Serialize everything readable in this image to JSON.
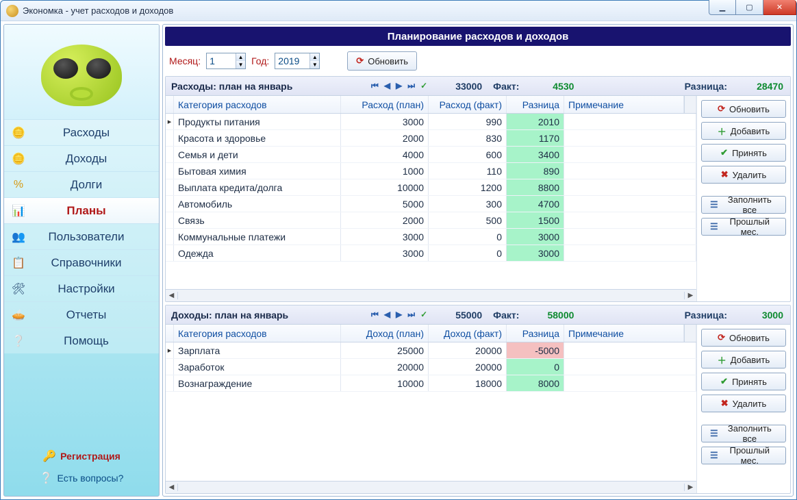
{
  "window": {
    "title": "Экономка - учет расходов и доходов"
  },
  "sidebar": {
    "items": [
      {
        "id": "expenses",
        "label": "Расходы"
      },
      {
        "id": "incomes",
        "label": "Доходы"
      },
      {
        "id": "debts",
        "label": "Долги"
      },
      {
        "id": "plans",
        "label": "Планы"
      },
      {
        "id": "users",
        "label": "Пользователи"
      },
      {
        "id": "refs",
        "label": "Справочники"
      },
      {
        "id": "settings",
        "label": "Настройки"
      },
      {
        "id": "reports",
        "label": "Отчеты"
      },
      {
        "id": "help",
        "label": "Помощь"
      }
    ],
    "active": "plans",
    "links": {
      "register": "Регистрация",
      "questions": "Есть вопросы?"
    }
  },
  "banner": "Планирование расходов и доходов",
  "filters": {
    "month_label": "Месяц:",
    "month_value": "1",
    "year_label": "Год:",
    "year_value": "2019",
    "refresh_btn": "Обновить"
  },
  "panes": {
    "expenses": {
      "title": "Расходы: план на январь",
      "plan_total": "33000",
      "fact_label": "Факт:",
      "fact_total": "4530",
      "diff_label": "Разница:",
      "diff_total": "28470",
      "columns": {
        "category": "Категория расходов",
        "plan": "Расход (план)",
        "fact": "Расход (факт)",
        "diff": "Разница",
        "note": "Примечание"
      },
      "rows": [
        {
          "category": "Продукты питания",
          "plan": "3000",
          "fact": "990",
          "diff": "2010"
        },
        {
          "category": "Красота и здоровье",
          "plan": "2000",
          "fact": "830",
          "diff": "1170"
        },
        {
          "category": "Семья и дети",
          "plan": "4000",
          "fact": "600",
          "diff": "3400"
        },
        {
          "category": "Бытовая химия",
          "plan": "1000",
          "fact": "110",
          "diff": "890"
        },
        {
          "category": "Выплата кредита/долга",
          "plan": "10000",
          "fact": "1200",
          "diff": "8800"
        },
        {
          "category": "Автомобиль",
          "plan": "5000",
          "fact": "300",
          "diff": "4700"
        },
        {
          "category": "Связь",
          "plan": "2000",
          "fact": "500",
          "diff": "1500"
        },
        {
          "category": "Коммунальные платежи",
          "plan": "3000",
          "fact": "0",
          "diff": "3000"
        },
        {
          "category": "Одежда",
          "plan": "3000",
          "fact": "0",
          "diff": "3000"
        }
      ]
    },
    "incomes": {
      "title": "Доходы: план на январь",
      "plan_total": "55000",
      "fact_label": "Факт:",
      "fact_total": "58000",
      "diff_label": "Разница:",
      "diff_total": "3000",
      "columns": {
        "category": "Категория расходов",
        "plan": "Доход (план)",
        "fact": "Доход (факт)",
        "diff": "Разница",
        "note": "Примечание"
      },
      "rows": [
        {
          "category": "Зарплата",
          "plan": "25000",
          "fact": "20000",
          "diff": "-5000",
          "neg": true
        },
        {
          "category": "Заработок",
          "plan": "20000",
          "fact": "20000",
          "diff": "0"
        },
        {
          "category": "Вознаграждение",
          "plan": "10000",
          "fact": "18000",
          "diff": "8000"
        }
      ]
    }
  },
  "action_buttons": {
    "refresh": "Обновить",
    "add": "Добавить",
    "accept": "Принять",
    "delete": "Удалить",
    "fill_all": "Заполнить все",
    "prev_month": "Прошлый мес."
  }
}
